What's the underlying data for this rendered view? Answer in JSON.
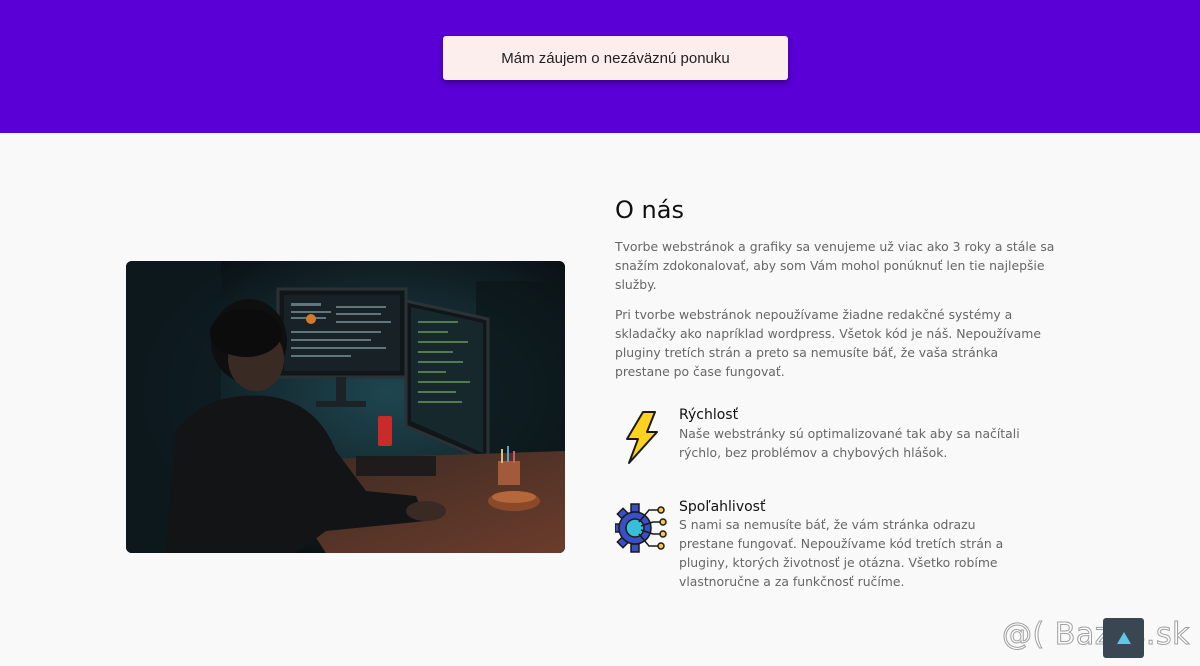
{
  "hero": {
    "cta_label": "Mám záujem o nezáväznú ponuku",
    "background": "#5a00d6"
  },
  "about": {
    "title": "O nás",
    "paragraphs": [
      "Tvorbe webstránok a grafiky sa venujeme už viac ako 3 roky a stále sa snažím zdokonalovať, aby som Vám mohol ponúknuť len tie najlepšie služby.",
      "Pri tvorbe webstránok nepoužívame žiadne redakčné systémy a skladačky ako napríklad wordpress. Všetok kód je náš. Nepoužívame pluginy tretích strán a preto sa nemusíte báť, že vaša stránka prestane po čase fungovať."
    ],
    "features": [
      {
        "icon": "lightning-bolt-icon",
        "title": "Rýchlosť",
        "text": "Naše webstránky sú optimalizované tak aby sa načítali rýchlo, bez problémov a chybových hlášok."
      },
      {
        "icon": "gear-network-icon",
        "title": "Spoľahlivosť",
        "text": "S nami sa nemusíte báť, že vám stránka odrazu prestane fungovať. Nepoužívame kód tretích strán a pluginy, ktorých životnosť je otázna. Všetko robíme vlastnoručne a za funkčnosť ručíme."
      }
    ]
  },
  "watermark": "@( Bazos.sk",
  "scroll_top_icon": "arrow-up-icon"
}
